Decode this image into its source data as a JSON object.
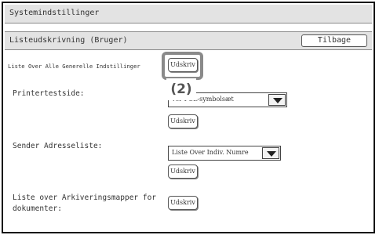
{
  "window": {
    "title": "Systemindstillinger"
  },
  "subheader": {
    "title": "Listeudskrivning (Bruger)",
    "back_label": "Tilbage"
  },
  "rows": [
    {
      "label": "Liste Over Alle Generelle Indstillinger",
      "button": "Udskriv"
    },
    {
      "label": "Printertestside:",
      "select_value": "PCL-symbolsæt",
      "select_value_visible": "ver PCL-symbolsæt",
      "button": "Udskriv"
    },
    {
      "label": "Sender Adresseliste:",
      "select_value": "Liste Over Indiv. Numre",
      "button": "Udskriv"
    },
    {
      "label_line1": "Liste over Arkiveringsmapper for",
      "label_line2": "dokumenter:",
      "button": "Udskriv"
    }
  ],
  "annotation": {
    "callout": "(2)"
  }
}
